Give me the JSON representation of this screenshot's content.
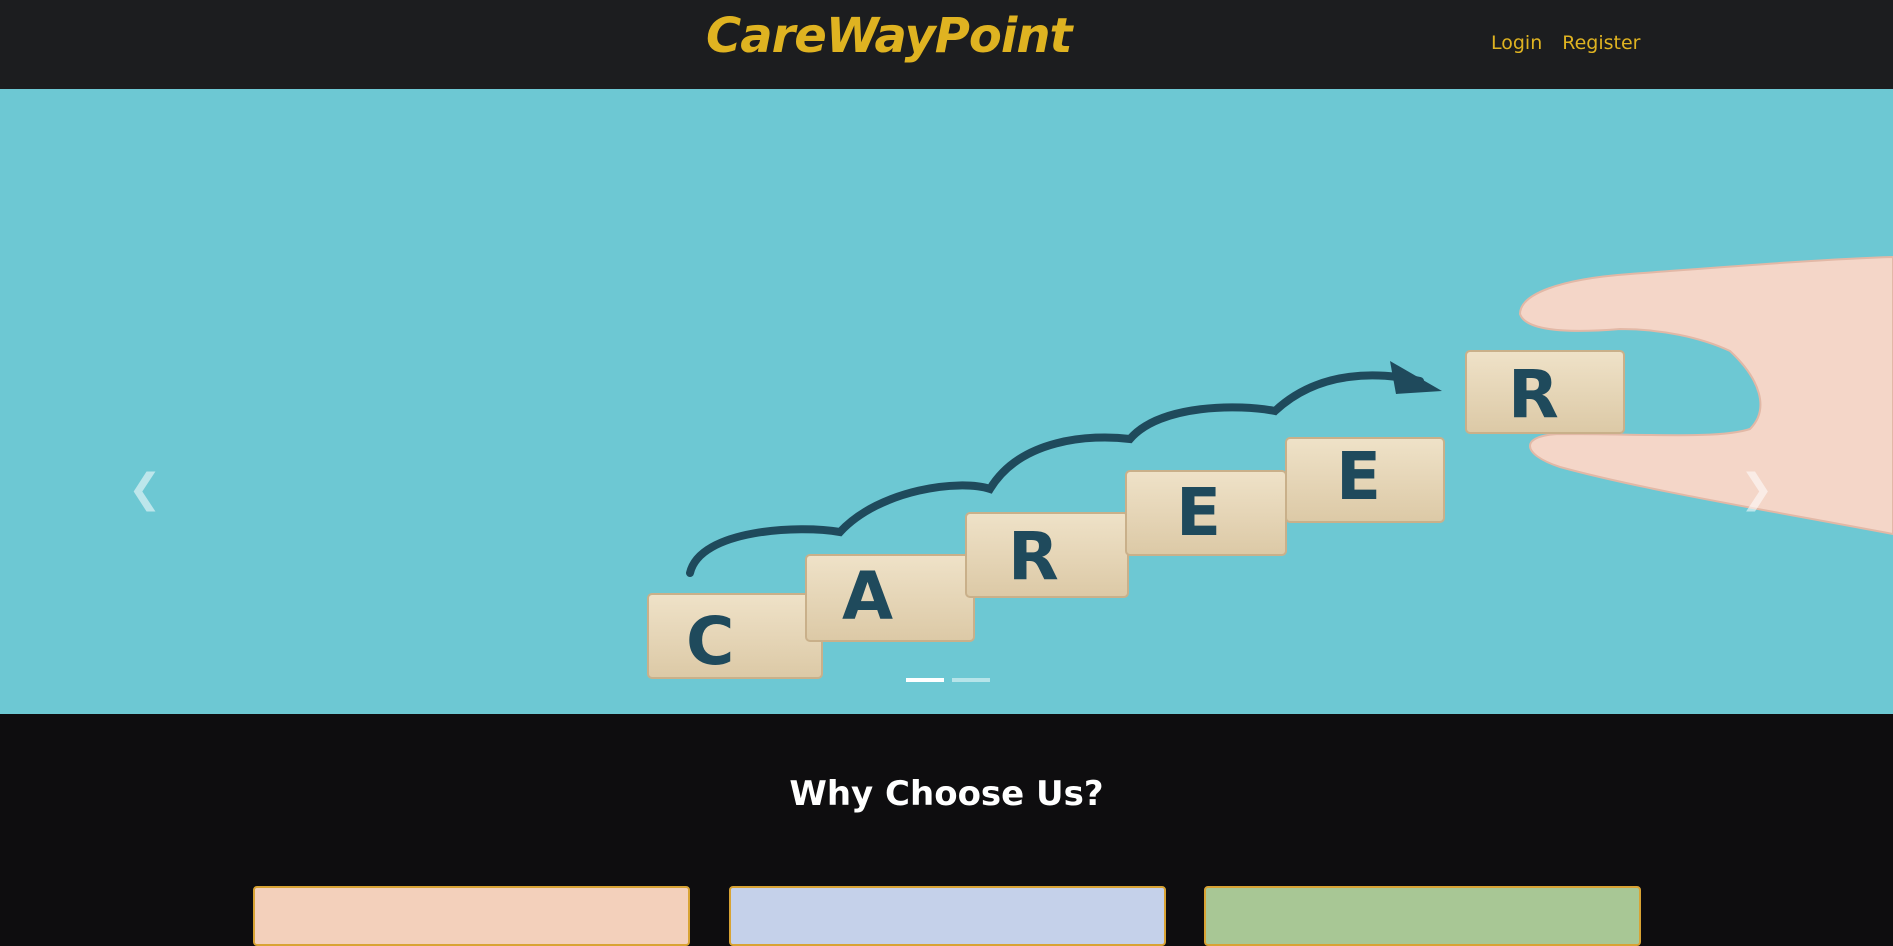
{
  "navbar": {
    "brand": "CareWayPoint",
    "links": [
      {
        "label": "Login"
      },
      {
        "label": "Register"
      }
    ]
  },
  "carousel": {
    "slide_letters": [
      "C",
      "A",
      "R",
      "E",
      "E",
      "R"
    ],
    "prev_icon": "chevron-left-icon",
    "next_icon": "chevron-right-icon",
    "indicator_count": 2,
    "active_indicator": 1
  },
  "why": {
    "title": "Why Choose Us?"
  },
  "colors": {
    "brand": "#dfb321",
    "navbar_bg": "#1c1d1f",
    "page_bg": "#0e0d0f",
    "slide_bg": "#6dc8d3",
    "card_1": "#f3d0bb",
    "card_2": "#c5d1ea",
    "card_3": "#a8c795"
  }
}
